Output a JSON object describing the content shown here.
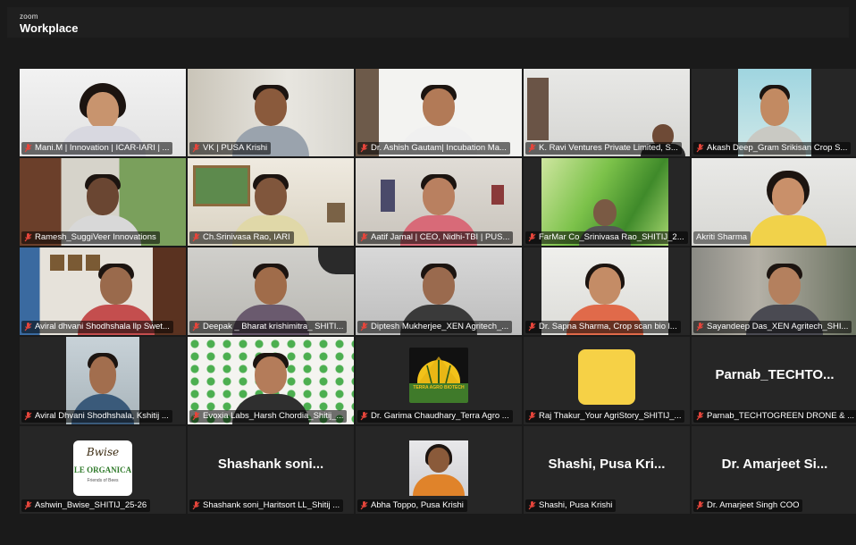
{
  "app": {
    "brand_small": "zoom",
    "brand_big": "Workplace"
  },
  "colors": {
    "background": "#1a1a1a",
    "tile": "#262626",
    "speaking_border": "#3ecf6b",
    "muted_icon": "#e5453b"
  },
  "tiles": [
    {
      "name": "Mani.M | Innovation | ICAR-IARI | ..."
    },
    {
      "name": "VK | PUSA Krishi"
    },
    {
      "name": "Dr. Ashish Gautam| Incubation Ma..."
    },
    {
      "name": "K. Ravi Ventures Private Limited, S..."
    },
    {
      "name": "Akash Deep_Gram Srikisan Crop S..."
    },
    {
      "name": "Ramesh_SuggiVeer Innovations"
    },
    {
      "name": "Ch.Srinivasa Rao, IARI"
    },
    {
      "name": "Aatif Jamal | CEO, Nidhi-TBI | PUS..."
    },
    {
      "name": "FarMar Co_Srinivasa Rao_SHITIJ_2..."
    },
    {
      "name": "Akriti Sharma"
    },
    {
      "name": "Aviral dhvani Shodhshala llp Swet..."
    },
    {
      "name": "Deepak _ Bharat krishimitra_ SHITI..."
    },
    {
      "name": "Diptesh Mukherjee_XEN Agritech_..."
    },
    {
      "name": "Dr. Sapna Sharma, Crop scan bio l..."
    },
    {
      "name": "Sayandeep Das_XEN Agritech_SHI..."
    },
    {
      "name": "Aviral Dhvani Shodhshala, Kshitij ..."
    },
    {
      "name": "Evoxia Labs_Harsh Chordia_Shitij_..."
    },
    {
      "name": "Dr. Garima Chaudhary_Terra Agro ..."
    },
    {
      "name": "Raj Thakur_Your AgriStory_SHITIJ_..."
    },
    {
      "name": "Parnab_TECHTOGREEN DRONE & ...",
      "display": "Parnab_TECHTO..."
    },
    {
      "name": "Ashwin_Bwise_SHITIJ_25-26"
    },
    {
      "name": "Shashank soni_Haritsort LL_Shitij ...",
      "display": "Shashank soni..."
    },
    {
      "name": "Abha Toppo, Pusa Krishi"
    },
    {
      "name": "Shashi, Pusa Krishi",
      "display": "Shashi, Pusa Kri..."
    },
    {
      "name": "Dr. Amarjeet Singh COO",
      "display": "Dr. Amarjeet Si..."
    }
  ],
  "logos": {
    "terra": "TERRA AGRO BIOTECH",
    "organica_main": "LE ORGANICA",
    "organica_sub": "Friends of Bees",
    "organica_script": "Bwise"
  }
}
